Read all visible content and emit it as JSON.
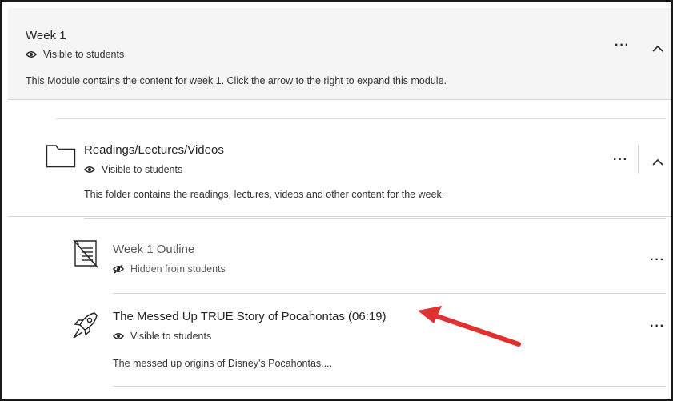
{
  "module": {
    "title": "Week 1",
    "visibility": "Visible to students",
    "description": "This Module contains the content for week 1. Click the arrow to the right to expand this module.",
    "more_label": "···"
  },
  "folder": {
    "title": "Readings/Lectures/Videos",
    "visibility": "Visible to students",
    "description": "This folder contains the readings, lectures, videos and other content for the week.",
    "more_label": "···"
  },
  "items": [
    {
      "title": "Week 1 Outline",
      "visibility": "Hidden from students",
      "icon": "document-icon",
      "more_label": "···"
    },
    {
      "title": "The Messed Up TRUE Story of Pocahontas (06:19)",
      "visibility": "Visible to students",
      "description": "The messed up origins of Disney's Pocahontas....",
      "icon": "rocket-icon",
      "more_label": "···"
    }
  ],
  "colors": {
    "header_bg": "#f5f5f5",
    "arrow": "#e03131",
    "divider": "#d7d7d7"
  }
}
